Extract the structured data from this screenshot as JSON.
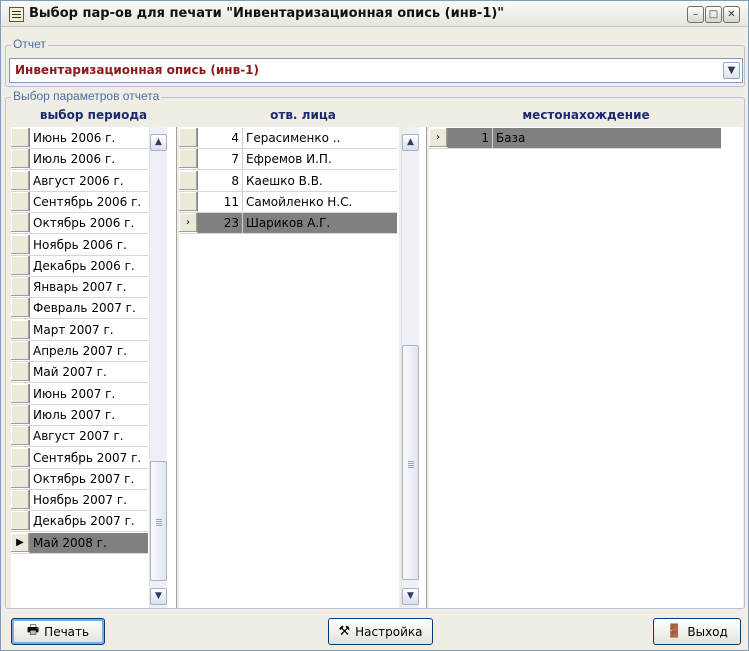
{
  "window": {
    "title": "Выбор пар-ов для печати \"Инвентаризационная опись (инв-1)\"",
    "controls": {
      "minimize": "–",
      "restore": "□",
      "close": "✕"
    }
  },
  "report_group": {
    "label": "Отчет",
    "selected": "Инвентаризационная опись (инв-1)"
  },
  "params_group": {
    "label": "Выбор параметров отчета"
  },
  "period": {
    "header": "выбор периода",
    "rows": [
      "Июнь 2006 г.",
      "Июль 2006 г.",
      "Август 2006 г.",
      "Сентябрь 2006 г.",
      "Октябрь 2006 г.",
      "Ноябрь 2006 г.",
      "Декабрь 2006 г.",
      "Январь 2007 г.",
      "Февраль 2007 г.",
      "Март 2007 г.",
      "Апрель 2007 г.",
      "Май 2007 г.",
      "Июнь 2007 г.",
      "Июль 2007 г.",
      "Август 2007 г.",
      "Сентябрь 2007 г.",
      "Октябрь 2007 г.",
      "Ноябрь 2007 г.",
      "Декабрь 2007 г.",
      "Май 2008 г."
    ],
    "selected_index": 19
  },
  "persons": {
    "header": "отв. лица",
    "rows": [
      {
        "num": "4",
        "name": "Герасименко .."
      },
      {
        "num": "7",
        "name": "Ефремов И.П."
      },
      {
        "num": "8",
        "name": "Каешко В.В."
      },
      {
        "num": "11",
        "name": "Самойленко Н.С."
      },
      {
        "num": "23",
        "name": "Шариков А.Г."
      }
    ],
    "selected_index": 4
  },
  "locations": {
    "header": "местонахождение",
    "rows": [
      {
        "num": "1",
        "name": "База"
      }
    ],
    "selected_index": 0
  },
  "buttons": {
    "print": "Печать",
    "settings": "Настройка",
    "exit": "Выход"
  },
  "icons": {
    "print": "printer-icon",
    "settings": "tools-icon",
    "exit": "exit-door-icon"
  }
}
